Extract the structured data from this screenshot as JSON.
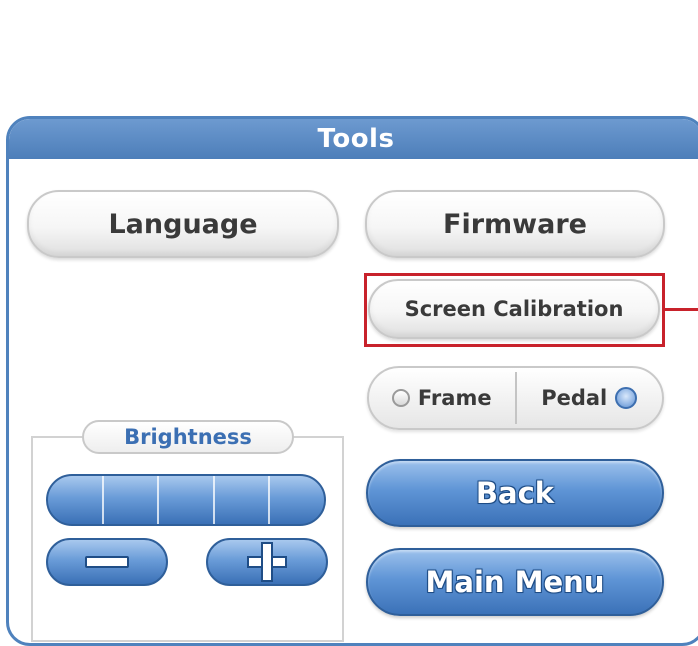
{
  "panel": {
    "title": "Tools"
  },
  "buttons": {
    "language": "Language",
    "firmware": "Firmware",
    "screen_calibration": "Screen Calibration",
    "back": "Back",
    "main_menu": "Main Menu"
  },
  "mode_toggle": {
    "frame_label": "Frame",
    "pedal_label": "Pedal",
    "selected": "Pedal"
  },
  "brightness": {
    "label": "Brightness",
    "segments": 5
  },
  "colors": {
    "accent_blue": "#4f82bd",
    "highlight_red": "#c8222b"
  },
  "icons": [
    "minus-icon",
    "plus-icon",
    "radio-icon"
  ]
}
